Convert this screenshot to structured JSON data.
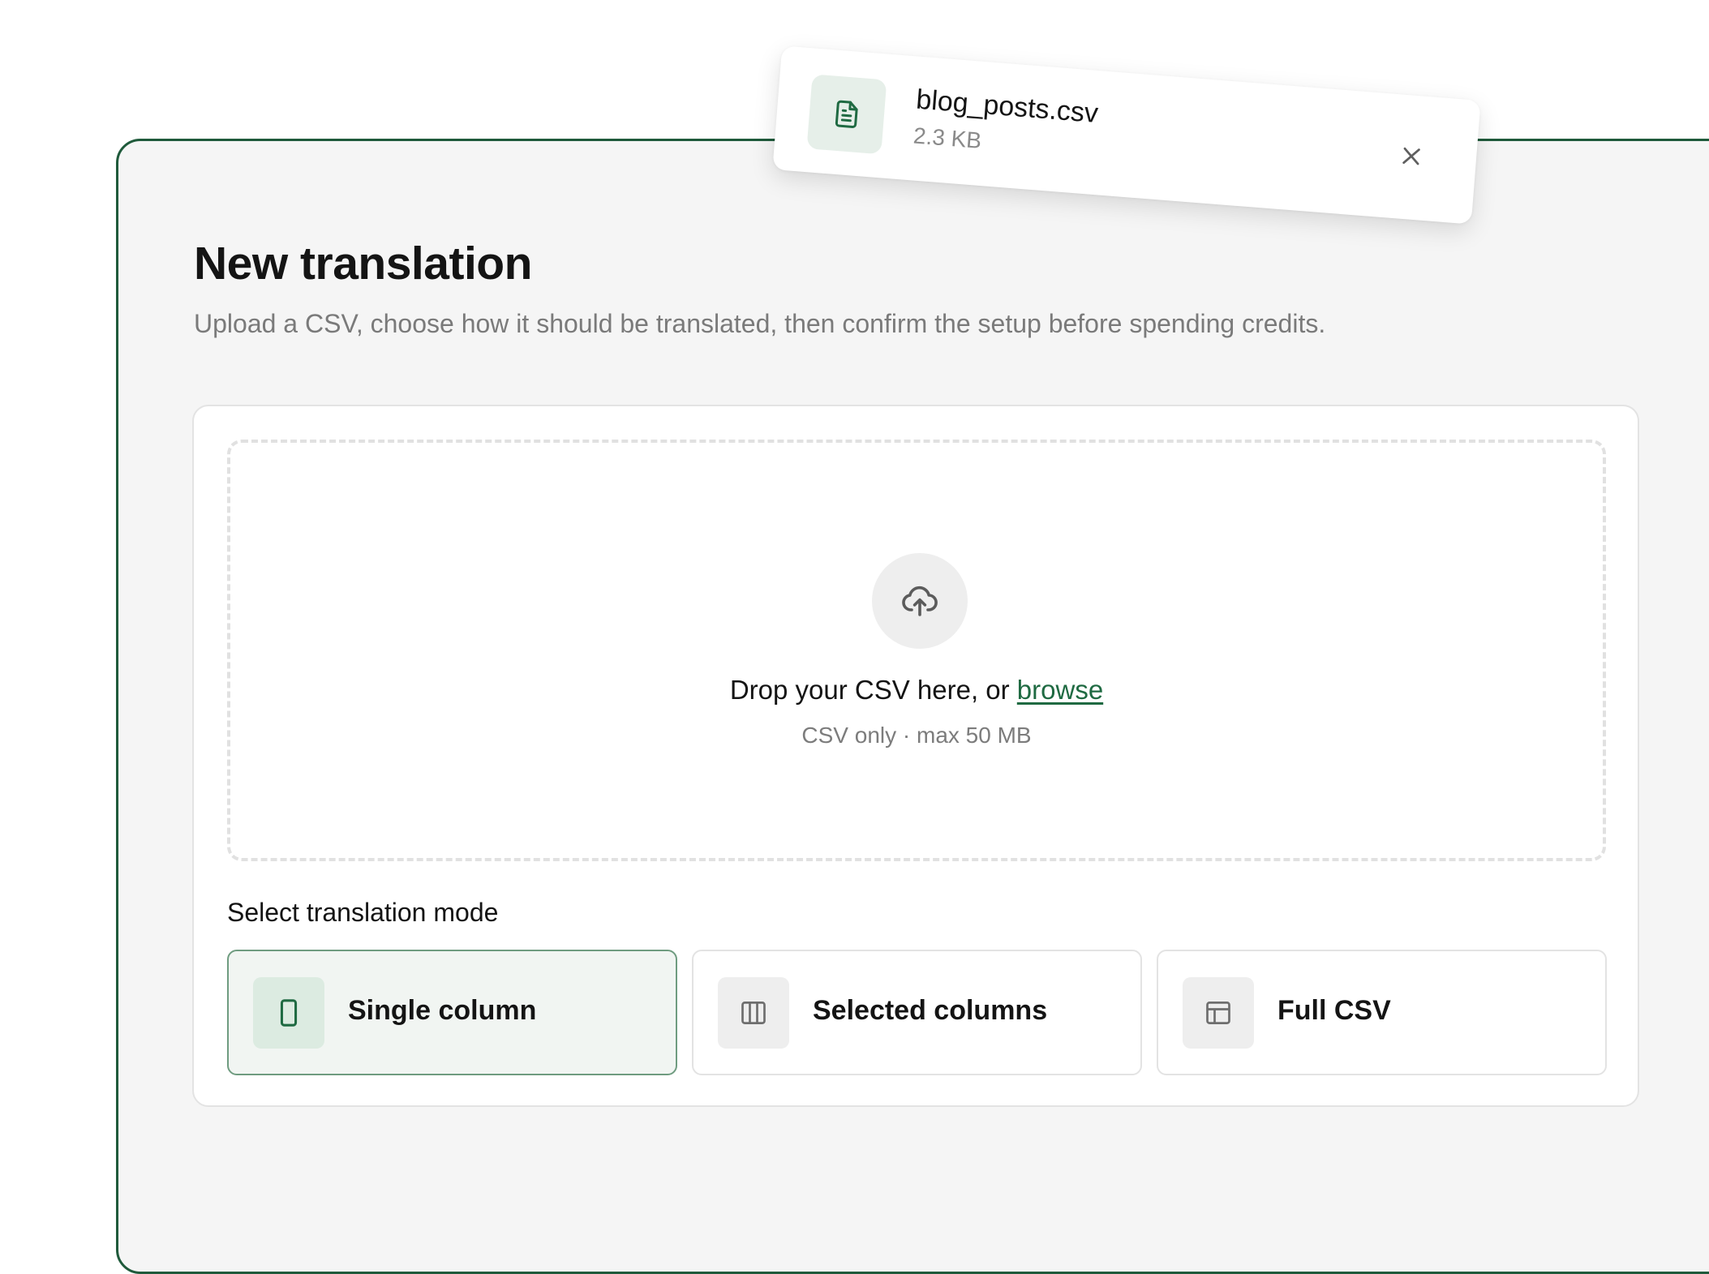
{
  "page": {
    "title": "New translation",
    "subtitle": "Upload a CSV, choose how it should be translated, then confirm the setup before spending credits."
  },
  "dropzone": {
    "prompt": "Drop your CSV here, or",
    "browse_label": "browse",
    "hint": "CSV only · max 50 MB",
    "icon": "cloud-upload-icon"
  },
  "mode_section": {
    "label": "Select translation mode",
    "options": [
      {
        "label": "Single column",
        "icon": "single-column-icon",
        "selected": true
      },
      {
        "label": "Selected columns",
        "icon": "columns-icon",
        "selected": false
      },
      {
        "label": "Full CSV",
        "icon": "table-icon",
        "selected": false
      }
    ]
  },
  "file": {
    "name": "blog_posts.csv",
    "size": "2.3 KB",
    "icon": "file-text-icon"
  },
  "colors": {
    "accent": "#1f6a42",
    "frame_border": "#1f5a3b",
    "selected_bg": "#f1f5f2",
    "selected_border": "#6f9c80"
  }
}
